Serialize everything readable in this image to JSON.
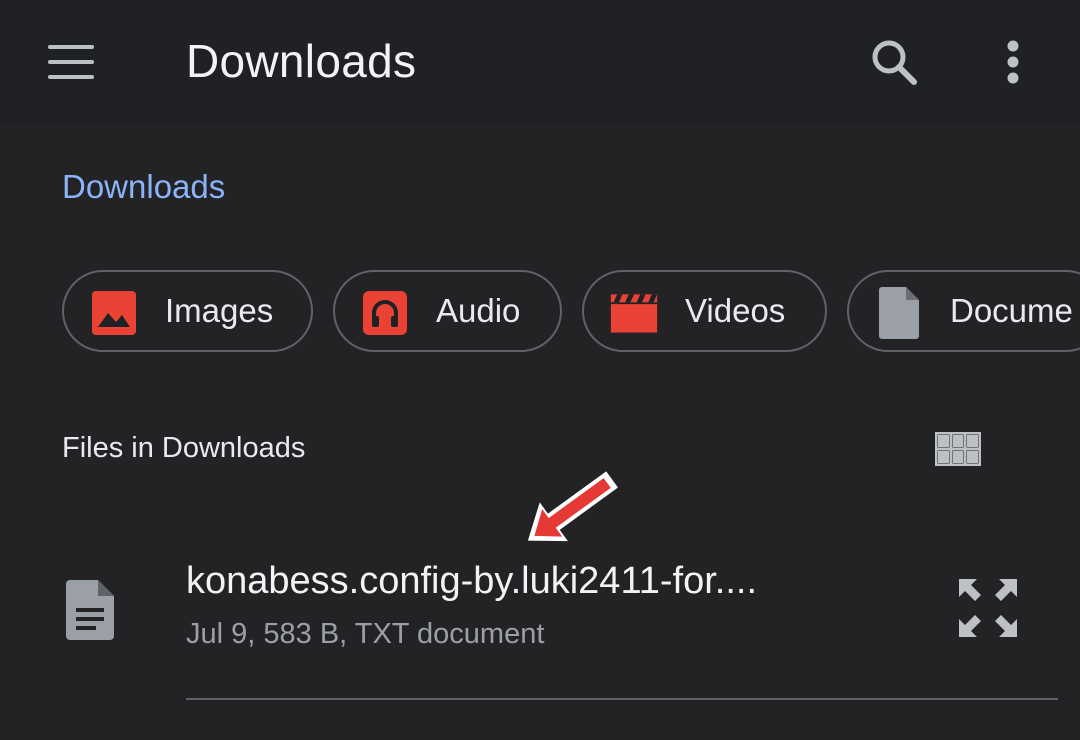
{
  "appbar": {
    "title": "Downloads",
    "menu_icon": "hamburger-menu-icon",
    "search_icon": "search-icon",
    "more_icon": "more-vert-icon"
  },
  "breadcrumb": "Downloads",
  "chips": [
    {
      "label": "Images",
      "icon": "image-icon",
      "color": "#ea4335"
    },
    {
      "label": "Audio",
      "icon": "headphones-icon",
      "color": "#ea4335"
    },
    {
      "label": "Videos",
      "icon": "clapperboard-icon",
      "color": "#ea4335"
    },
    {
      "label": "Docume",
      "icon": "document-icon",
      "color": "#9aa0a6"
    }
  ],
  "section": {
    "label": "Files in Downloads",
    "view_toggle_icon": "grid-view-icon"
  },
  "files": [
    {
      "name": "konabess.config-by.luki2411-for....",
      "meta": "Jul 9, 583 B, TXT document",
      "icon": "text-file-icon",
      "action_icon": "expand-icon"
    }
  ],
  "colors": {
    "background": "#202124",
    "accent": "#8ab4f8",
    "annotation_arrow": "#e53935"
  }
}
